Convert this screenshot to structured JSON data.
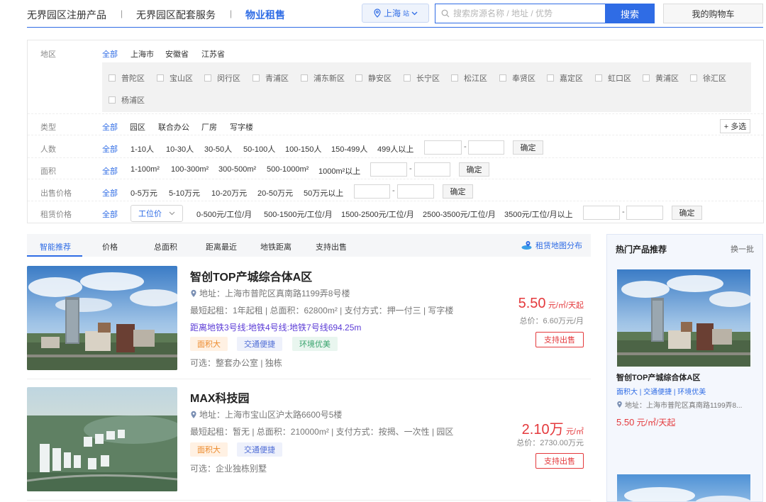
{
  "nav": {
    "links": [
      "无界园区注册产品",
      "无界园区配套服务",
      "物业租售"
    ],
    "separator": "|",
    "city": "上海",
    "city_suffix": "站",
    "search_placeholder": "搜索房源名称 / 地址 / 优势",
    "search_button": "搜索",
    "cart": "我的购物车"
  },
  "filters": {
    "region": {
      "label": "地区",
      "options": [
        "全部",
        "上海市",
        "安徽省",
        "江苏省"
      ],
      "districts": [
        "普陀区",
        "宝山区",
        "闵行区",
        "青浦区",
        "浦东新区",
        "静安区",
        "长宁区",
        "松江区",
        "奉贤区",
        "嘉定区",
        "虹口区",
        "黄浦区",
        "徐汇区",
        "杨浦区"
      ]
    },
    "type": {
      "label": "类型",
      "options": [
        "全部",
        "园区",
        "联合办公",
        "厂房",
        "写字楼"
      ],
      "more": "+ 多选"
    },
    "people": {
      "label": "人数",
      "options": [
        "全部",
        "1-10人",
        "10-30人",
        "30-50人",
        "50-100人",
        "100-150人",
        "150-499人",
        "499人以上"
      ]
    },
    "area": {
      "label": "面积",
      "options": [
        "全部",
        "1-100m²",
        "100-300m²",
        "300-500m²",
        "500-1000m²",
        "1000m²以上"
      ]
    },
    "sale_price": {
      "label": "出售价格",
      "options": [
        "全部",
        "0-5万元",
        "5-10万元",
        "10-20万元",
        "20-50万元",
        "50万元以上"
      ]
    },
    "rent_price": {
      "label": "租赁价格",
      "options": [
        "全部",
        "0-500元/工位/月",
        "500-1500元/工位/月",
        "1500-2500元/工位/月",
        "2500-3500元/工位/月",
        "3500元/工位/月以上"
      ],
      "select_value": "工位价"
    },
    "dash": "-",
    "confirm": "确定"
  },
  "sort": {
    "tabs": [
      "智能推荐",
      "价格",
      "总面积",
      "距离最近",
      "地铁距离",
      "支持出售"
    ],
    "map_link": "租赁地图分布"
  },
  "listings": [
    {
      "title": "智创TOP产城综合体A区",
      "address": "地址：上海市普陀区真南路1199弄8号楼",
      "info": "最短起租：1年起租 | 总面积：62800m² | 支付方式：押一付三 | 写字楼",
      "metro": "距离地铁3号线:地铁4号线:地铁7号线694.25m",
      "tags": [
        "面积大",
        "交通便捷",
        "环境优美"
      ],
      "optional": "可选：整套办公室 | 独栋",
      "price_num": "5.50",
      "price_unit": "元/㎡/天起",
      "total": "总价：6.60万元/月",
      "button": "支持出售"
    },
    {
      "title": "MAX科技园",
      "address": "地址：上海市宝山区沪太路6600号5楼",
      "info": "最短起租：暂无 | 总面积：210000m² | 支付方式：按揭、一次性 | 园区",
      "metro": "",
      "tags": [
        "面积大",
        "交通便捷"
      ],
      "optional": "可选：企业独栋别墅",
      "price_num": "2.10万",
      "price_unit": "元/㎡",
      "total": "总价：2730.00万元",
      "button": "支持出售"
    }
  ],
  "hot": {
    "heading": "热门产品推荐",
    "change": "换一批",
    "title": "智创TOP产城综合体A区",
    "tags": "面积大 | 交通便捷 | 环境优美",
    "address": "地址：上海市普陀区真南路1199弄8...",
    "price_num": "5.50",
    "price_unit": " 元/㎡/天起"
  },
  "colors": {
    "accent": "#2f6ce5",
    "price": "#e4393c"
  }
}
